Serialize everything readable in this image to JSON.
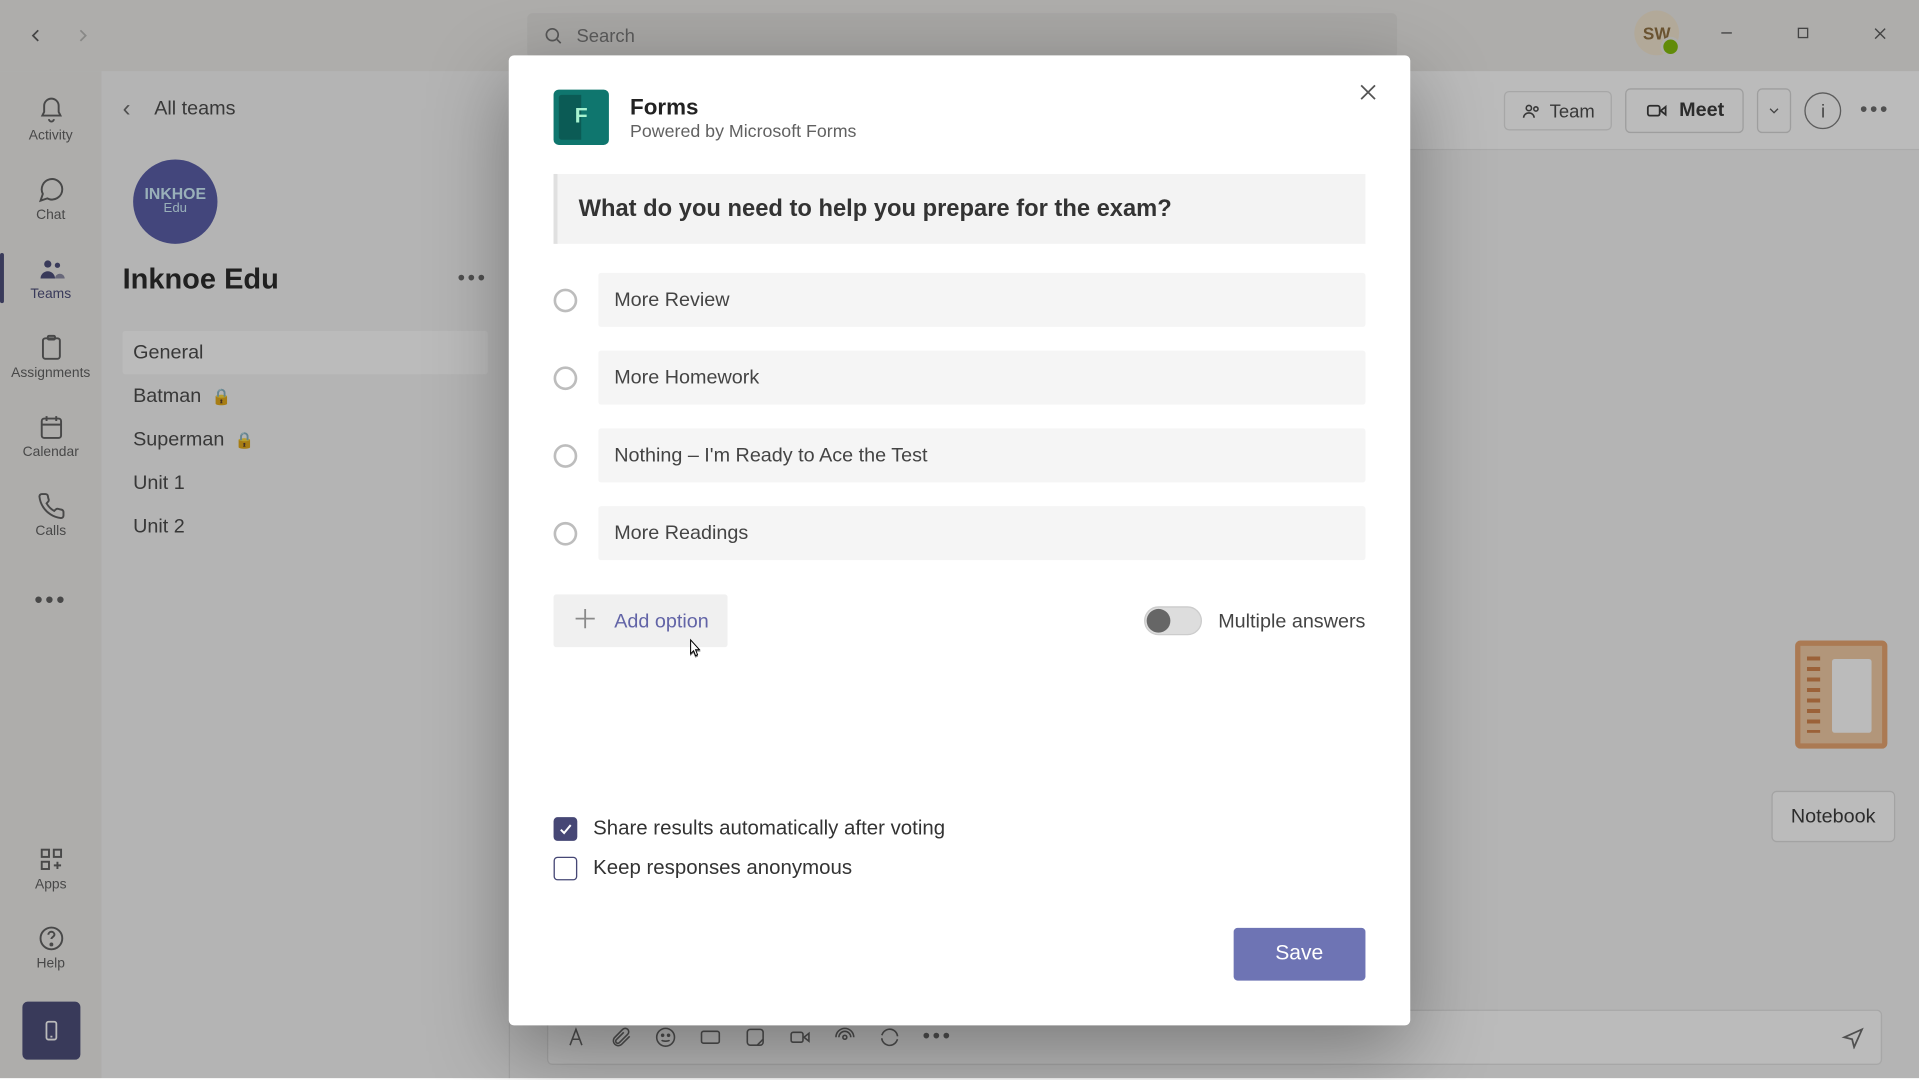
{
  "titlebar": {
    "search_placeholder": "Search",
    "avatar_initials": "SW"
  },
  "apprail": {
    "items": [
      {
        "label": "Activity"
      },
      {
        "label": "Chat"
      },
      {
        "label": "Teams"
      },
      {
        "label": "Assignments"
      },
      {
        "label": "Calendar"
      },
      {
        "label": "Calls"
      }
    ],
    "apps_label": "Apps",
    "help_label": "Help"
  },
  "sidepanel": {
    "back_label": "All teams",
    "team_logo_line1": "INKHOE",
    "team_logo_line2": "Edu",
    "team_name": "Inknoe Edu",
    "channels": [
      {
        "name": "General",
        "private": false,
        "active": true
      },
      {
        "name": "Batman",
        "private": true,
        "active": false
      },
      {
        "name": "Superman",
        "private": true,
        "active": false
      },
      {
        "name": "Unit 1",
        "private": false,
        "active": false
      },
      {
        "name": "Unit 2",
        "private": false,
        "active": false
      }
    ]
  },
  "mainheader": {
    "team_chip": "Team",
    "meet_label": "Meet"
  },
  "main": {
    "notebook_chip": "Notebook"
  },
  "modal": {
    "title": "Forms",
    "subtitle": "Powered by Microsoft Forms",
    "question": "What do you need to help you prepare for the exam?",
    "options": [
      "More Review",
      "More Homework",
      "Nothing – I'm Ready to Ace the Test",
      "More Readings"
    ],
    "add_option_label": "Add option",
    "multiple_answers_label": "Multiple answers",
    "share_results_label": "Share results automatically after voting",
    "anonymous_label": "Keep responses anonymous",
    "save_label": "Save"
  }
}
